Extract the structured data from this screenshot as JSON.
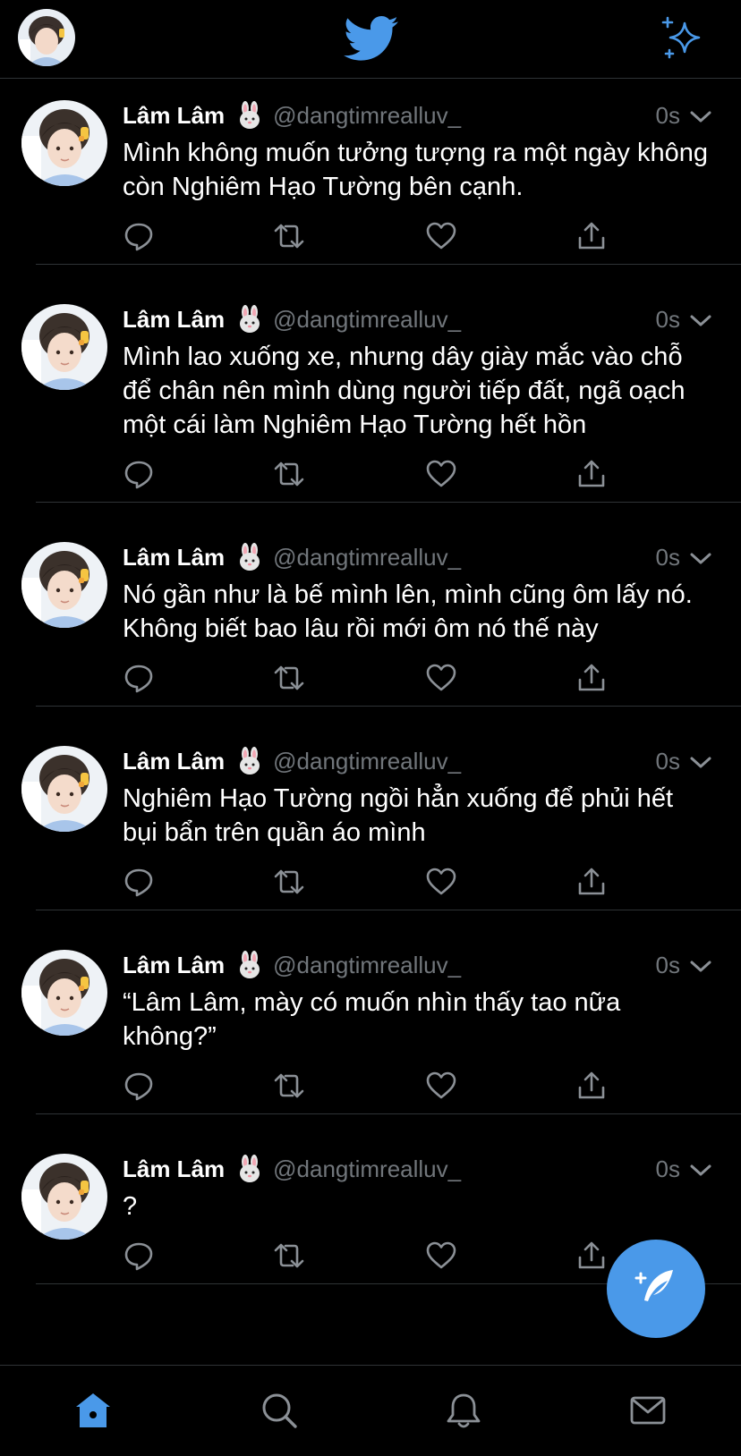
{
  "colors": {
    "background": "#000000",
    "accent": "#4a99e9",
    "muted_text": "#71767b",
    "divider": "#2f3336"
  },
  "header": {
    "profile_icon": "avatar",
    "logo_icon": "twitter-bird-icon",
    "top_tweets_icon": "sparkle-icon"
  },
  "tweets": [
    {
      "display_name": "Lâm Lâm",
      "emoji": "rabbit-face-icon",
      "handle": "@dangtimrealluv_",
      "time": "0s",
      "text": "Mình không muốn tưởng tượng ra một ngày không còn Nghiêm Hạo Tường bên cạnh."
    },
    {
      "display_name": "Lâm Lâm",
      "emoji": "rabbit-face-icon",
      "handle": "@dangtimrealluv_",
      "time": "0s",
      "text": "Mình lao xuống xe, nhưng dây giày mắc vào chỗ để chân nên mình dùng người tiếp đất, ngã oạch một cái làm Nghiêm Hạo Tường hết hồn"
    },
    {
      "display_name": "Lâm Lâm",
      "emoji": "rabbit-face-icon",
      "handle": "@dangtimrealluv_",
      "time": "0s",
      "text": "Nó gần như là bế mình lên, mình cũng ôm lấy nó. Không biết bao lâu rồi mới ôm nó thế này"
    },
    {
      "display_name": "Lâm Lâm",
      "emoji": "rabbit-face-icon",
      "handle": "@dangtimrealluv_",
      "time": "0s",
      "text": "Nghiêm Hạo Tường ngồi hẳn xuống để phủi hết bụi bẩn trên quần áo mình"
    },
    {
      "display_name": "Lâm Lâm",
      "emoji": "rabbit-face-icon",
      "handle": "@dangtimrealluv_",
      "time": "0s",
      "text": "“Lâm Lâm, mày có muốn nhìn thấy tao nữa không?”"
    },
    {
      "display_name": "Lâm Lâm",
      "emoji": "rabbit-face-icon",
      "handle": "@dangtimrealluv_",
      "time": "0s",
      "text": "?"
    }
  ],
  "actions": [
    "reply-icon",
    "retweet-icon",
    "like-icon",
    "share-icon"
  ],
  "fab": {
    "icon": "compose-tweet-icon"
  },
  "bottom_nav": {
    "items": [
      "home-icon",
      "search-icon",
      "notifications-icon",
      "messages-icon"
    ],
    "active": "home-icon"
  }
}
